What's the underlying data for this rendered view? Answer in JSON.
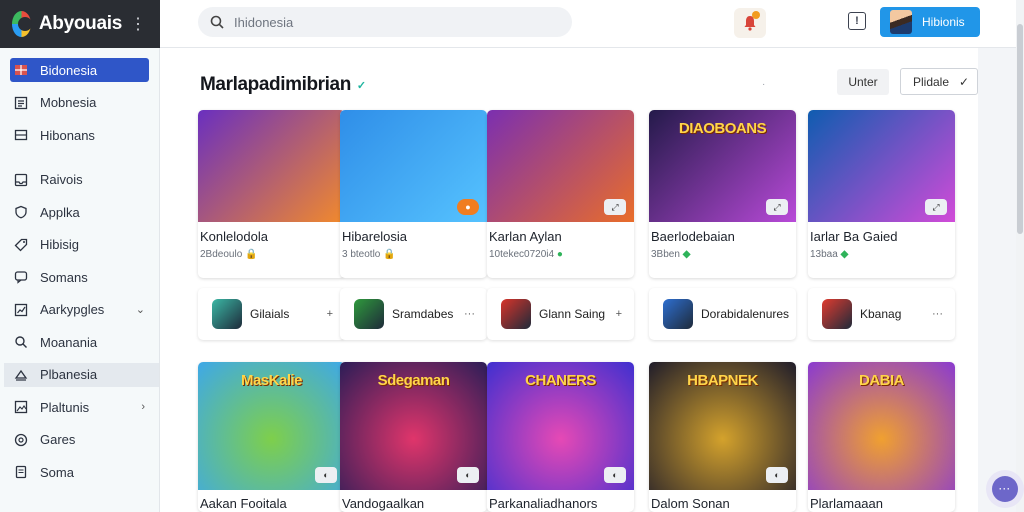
{
  "app": {
    "name": "Abyouais",
    "more_icon": "more-vertical-icon"
  },
  "search": {
    "placeholder": "Ihidonesia",
    "icon": "search-icon"
  },
  "header": {
    "user_button_label": "Hibionis",
    "notification_icon": "bell-icon",
    "info_icon": "info-icon"
  },
  "sidebar": {
    "items": [
      {
        "label": "Bidonesia",
        "icon": "flag-icon",
        "active": true
      },
      {
        "label": "Mobnesia",
        "icon": "list-icon"
      },
      {
        "label": "Hibonans",
        "icon": "panel-icon"
      },
      {
        "label": "Raivois",
        "icon": "tray-icon"
      },
      {
        "label": "Applka",
        "icon": "shield-icon"
      },
      {
        "label": "Hibisig",
        "icon": "tag-icon"
      },
      {
        "label": "Somans",
        "icon": "chat-icon"
      },
      {
        "label": "Aarkypgles",
        "icon": "chart-icon",
        "expand": "chevron-down"
      },
      {
        "label": "Moanania",
        "icon": "magnifier-icon"
      },
      {
        "label": "Plbanesia",
        "icon": "play-icon",
        "hover": true
      },
      {
        "label": "Plaltunis",
        "icon": "gallery-icon",
        "expand": "chevron-right"
      },
      {
        "label": "Gares",
        "icon": "target-icon"
      },
      {
        "label": "Soma",
        "icon": "document-icon"
      }
    ]
  },
  "main": {
    "title": "Marlapadimibrian",
    "title_check": "✓",
    "dots": "·",
    "user_filter_label": "Unter",
    "sort_label": "Plidale",
    "sort_icon": "check-icon"
  },
  "featured": [
    {
      "name": "Konlelodola",
      "meta": "2Bdeoulo",
      "meta_icon": "🔒",
      "badge": "",
      "colors": [
        "#6a2fbf",
        "#f28a2c"
      ],
      "thumb_text": ""
    },
    {
      "name": "Hibarelosia",
      "meta": "3 bteotlo",
      "meta_icon": "🔒",
      "badge": "●",
      "colors": [
        "#2f8ee8",
        "#56c3ff"
      ],
      "thumb_text": ""
    },
    {
      "name": "Karlan Aylan",
      "meta": "10tekec0720i4",
      "meta_icon": "●",
      "badge": "⤢",
      "colors": [
        "#7b2fb0",
        "#e96d2a"
      ],
      "thumb_text": ""
    },
    {
      "name": "Baerlodebaian",
      "meta": "3Bben",
      "meta_icon": "◆",
      "badge": "⤢",
      "colors": [
        "#241a4a",
        "#b84ad8"
      ],
      "thumb_text": "DIAOBOANS"
    },
    {
      "name": "Iarlar Ba Gaied",
      "meta": "13baa",
      "meta_icon": "◆",
      "badge": "⤢",
      "colors": [
        "#0f5cb0",
        "#d14bd8"
      ],
      "thumb_text": ""
    }
  ],
  "apps": [
    {
      "label": "Gilaials",
      "action": "+",
      "icon_color": "#3bb8a5"
    },
    {
      "label": "Sramdabes",
      "action": "···",
      "icon_color": "#2f9a3c"
    },
    {
      "label": "Glann Saing",
      "action": "+",
      "icon_color": "#d8342a"
    },
    {
      "label": "Dorabidalenures",
      "action": "",
      "icon_color": "#2e6fd1"
    },
    {
      "label": "Kbanag",
      "action": "···",
      "icon_color": "#e03b2f"
    }
  ],
  "games": [
    {
      "name": "Aakan Fooitala",
      "thumb_text": "MasKalie",
      "badge": "◐",
      "colors": [
        "#3ea8e8",
        "#7ecf4b"
      ]
    },
    {
      "name": "Vandogaalkan",
      "thumb_text": "Sdegaman",
      "badge": "◐",
      "colors": [
        "#2b1d57",
        "#e0356b"
      ]
    },
    {
      "name": "Parkanaliadhanors",
      "thumb_text": "CHANERS",
      "badge": "◐",
      "colors": [
        "#3f2fd0",
        "#e649b5"
      ]
    },
    {
      "name": "Dalom Sonan",
      "thumb_text": "HBAPNEK",
      "badge": "◐",
      "colors": [
        "#1f1c2a",
        "#d4a22c"
      ]
    },
    {
      "name": "Plarlamaaan",
      "thumb_text": "DABIA",
      "badge": "",
      "colors": [
        "#8a3ad0",
        "#f0a030"
      ]
    }
  ],
  "chat": {
    "label": "···",
    "icon": "chatbot-icon"
  }
}
